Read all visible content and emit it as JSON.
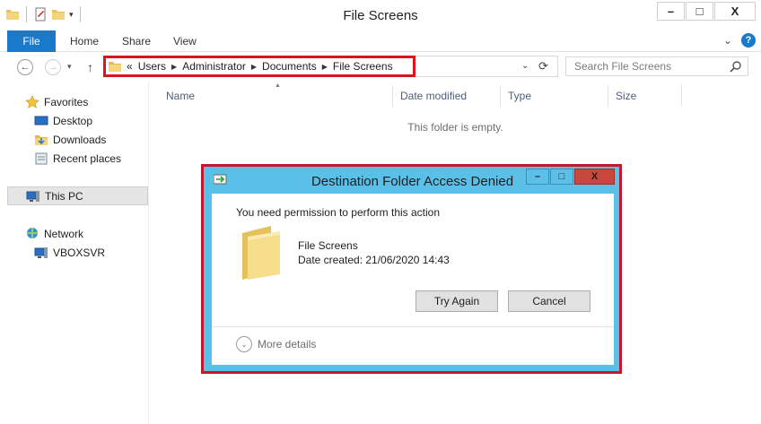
{
  "window": {
    "title": "File Screens",
    "controls": {
      "minimize": "–",
      "maximize": "□",
      "close": "X"
    }
  },
  "ribbon": {
    "tabs": [
      "File",
      "Home",
      "Share",
      "View"
    ],
    "expand_glyph": "⌄",
    "help": "?"
  },
  "address": {
    "prefix": "«",
    "crumbs": [
      "Users",
      "Administrator",
      "Documents",
      "File Screens"
    ],
    "search_placeholder": "Search File Screens"
  },
  "nav": {
    "favorites": "Favorites",
    "desktop": "Desktop",
    "downloads": "Downloads",
    "recent": "Recent places",
    "this_pc": "This PC",
    "network": "Network",
    "vboxsvr": "VBOXSVR"
  },
  "columns": [
    "Name",
    "Date modified",
    "Type",
    "Size"
  ],
  "empty_message": "This folder is empty.",
  "dialog": {
    "title": "Destination Folder Access Denied",
    "message": "You need permission to perform this action",
    "file_name": "File Screens",
    "date_created": "Date created: 21/06/2020 14:43",
    "try_again": "Try Again",
    "cancel": "Cancel",
    "more_details": "More details"
  },
  "colors": {
    "accent": "#1979ca",
    "highlight_border": "#d9161e",
    "dialog_frame": "#5ac0e8",
    "dialog_close": "#c9483c"
  }
}
